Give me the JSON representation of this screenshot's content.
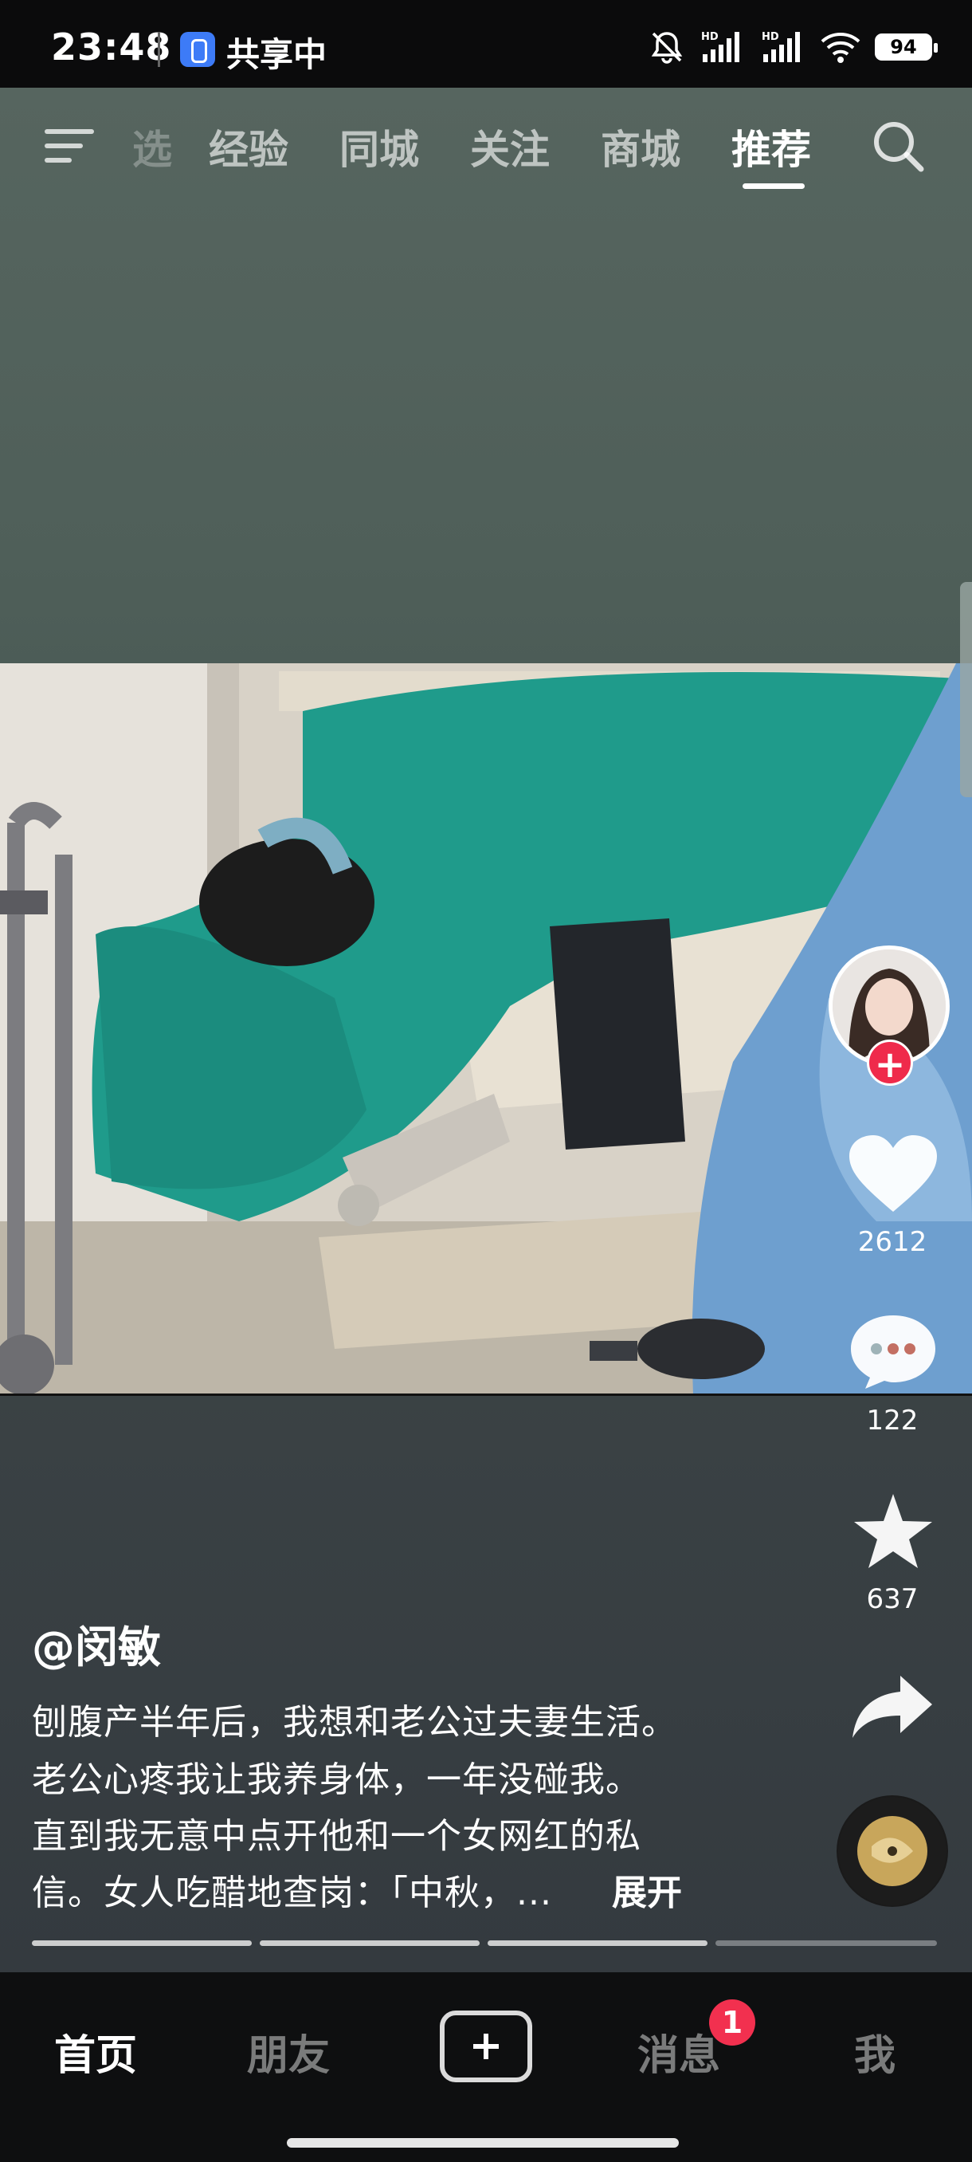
{
  "status_bar": {
    "time": "23:48",
    "sharing": "共享中",
    "battery": "94",
    "network_labels": [
      "HD",
      "HD"
    ]
  },
  "top_nav": {
    "tabs": [
      {
        "label": "选",
        "active": false,
        "partial": true
      },
      {
        "label": "经验",
        "active": false
      },
      {
        "label": "同城",
        "active": false
      },
      {
        "label": "关注",
        "active": false
      },
      {
        "label": "商城",
        "active": false
      },
      {
        "label": "推荐",
        "active": true
      }
    ],
    "icons": [
      "menu-icon",
      "search-icon"
    ]
  },
  "rail": {
    "likes": "2612",
    "comments": "122",
    "favorites": "637",
    "follow_symbol": "+",
    "icons": [
      "heart-icon",
      "comment-icon",
      "star-icon",
      "share-icon",
      "music-disc-icon"
    ]
  },
  "caption": {
    "author": "@闵敏",
    "lines": [
      "刨腹产半年后，我想和老公过夫妻生活。",
      "老公心疼我让我养身体，一年没碰我。",
      "直到我无意中点开他和一个女网红的私",
      "信。女人吃醋地查岗：「中秋，..."
    ],
    "expand_label": "展开"
  },
  "progress_segments": [
    1,
    1,
    1,
    0.25
  ],
  "bottom_nav": {
    "items": [
      "首页",
      "朋友",
      "消息",
      "我"
    ],
    "active": "首页",
    "create_icon": "plus-icon",
    "message_badge": "1"
  },
  "colors": {
    "accent_red": "#f2304f",
    "teal_sheet": "#1f9b8b",
    "bar_bg": "#0e0f10"
  }
}
